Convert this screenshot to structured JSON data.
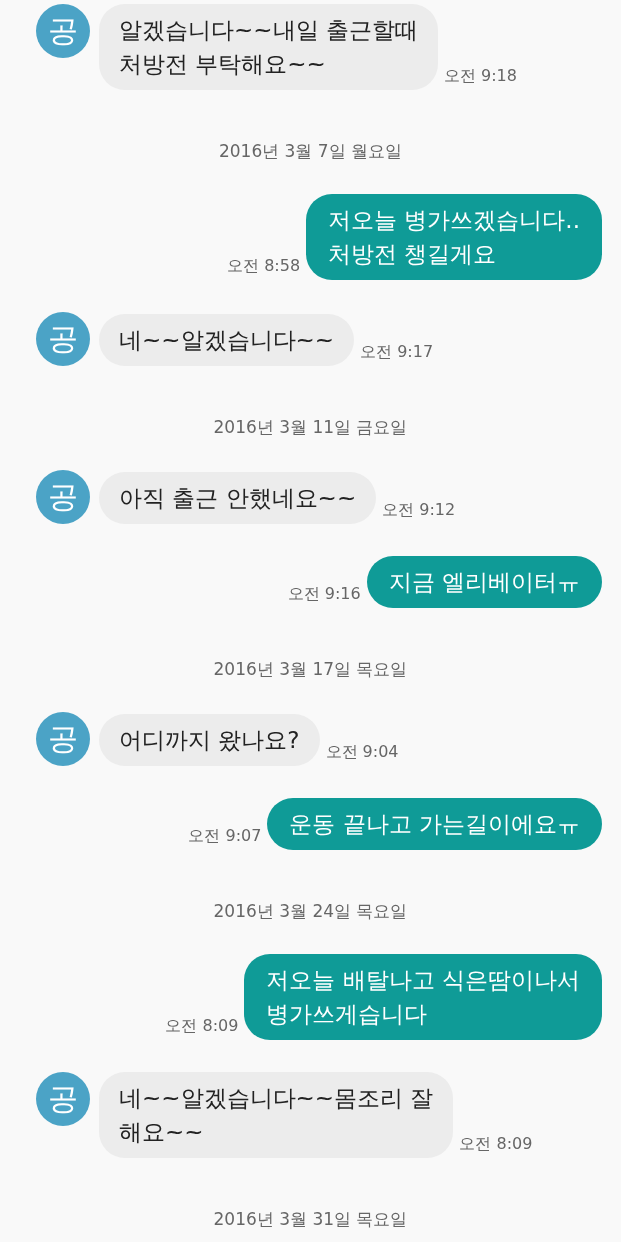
{
  "items": [
    {
      "kind": "received",
      "avatar": "공",
      "text": "알겠습니다~~내일 출근할때\n처방전 부탁해요~~",
      "time": "오전 9:18"
    },
    {
      "kind": "date",
      "text": "2016년 3월 7일 월요일"
    },
    {
      "kind": "sent",
      "text": "저오늘 병가쓰겠습니다..\n처방전 챙길게요",
      "time": "오전 8:58"
    },
    {
      "kind": "received",
      "avatar": "공",
      "text": "네~~알겠습니다~~",
      "time": "오전 9:17"
    },
    {
      "kind": "date",
      "text": "2016년 3월 11일 금요일"
    },
    {
      "kind": "received",
      "avatar": "공",
      "text": "아직 출근 안했네요~~",
      "time": "오전 9:12"
    },
    {
      "kind": "sent",
      "text": "지금 엘리베이터ㅠ",
      "time": "오전 9:16"
    },
    {
      "kind": "date",
      "text": "2016년 3월 17일 목요일"
    },
    {
      "kind": "received",
      "avatar": "공",
      "text": "어디까지 왔나요?",
      "time": "오전 9:04"
    },
    {
      "kind": "sent",
      "text": "운동 끝나고 가는길이에요ㅠ",
      "time": "오전 9:07"
    },
    {
      "kind": "date",
      "text": "2016년 3월 24일 목요일"
    },
    {
      "kind": "sent",
      "text": "저오늘 배탈나고 식은땀이나서\n병가쓰게습니다",
      "time": "오전 8:09"
    },
    {
      "kind": "received",
      "avatar": "공",
      "text": "네~~알겠습니다~~몸조리 잘\n해요~~",
      "time": "오전 8:09"
    },
    {
      "kind": "date",
      "text": "2016년 3월 31일 목요일"
    }
  ]
}
